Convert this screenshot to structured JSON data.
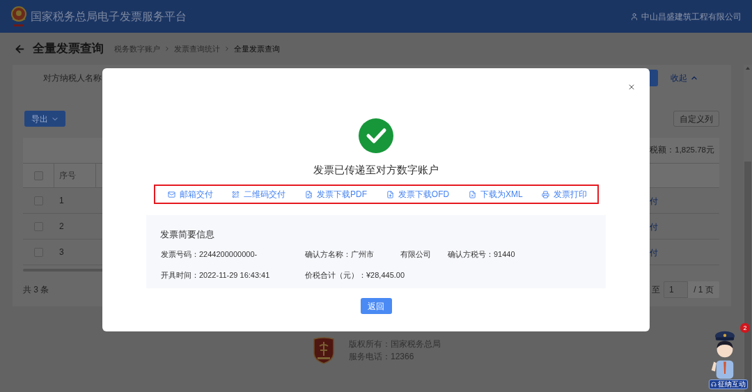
{
  "header": {
    "title": "国家税务总局电子发票服务平台",
    "user": "中山昌盛建筑工程有限公司"
  },
  "page": {
    "title": "全量发票查询",
    "breadcrumbs": [
      {
        "label": "税务数字账户",
        "current": false
      },
      {
        "label": "发票查询统计",
        "current": false
      },
      {
        "label": "全量发票查询",
        "current": true
      }
    ]
  },
  "filter": {
    "label": "对方纳税人名称",
    "collapse_link": "收起"
  },
  "toolbar": {
    "export_button": "导出",
    "columns_button": "自定义列"
  },
  "summary": {
    "text": "税额：1,825.78元"
  },
  "table": {
    "select_all": {
      "checked": false
    },
    "columns": [
      "序号"
    ],
    "rows": [
      {
        "checked": false,
        "index": "1",
        "action": "付"
      },
      {
        "checked": false,
        "index": "2",
        "action": "付"
      },
      {
        "checked": false,
        "index": "3",
        "action": "付"
      }
    ]
  },
  "pagination": {
    "total": "共 3 条",
    "jump_label": "至",
    "page_input": "1",
    "page_count": "/ 1 页"
  },
  "footer": {
    "copyright": "版权所有：国家税务总局",
    "phone": "服务电话：12366"
  },
  "assistant": {
    "badge": "2",
    "label": "征纳互动"
  },
  "dialog": {
    "message": "发票已传递至对方数字账户",
    "actions": [
      {
        "kind": "mail",
        "label": "邮箱交付"
      },
      {
        "kind": "qrcode",
        "label": "二维码交付"
      },
      {
        "kind": "pdf",
        "label": "发票下载PDF"
      },
      {
        "kind": "ofd",
        "label": "发票下载OFD"
      },
      {
        "kind": "xml",
        "label": "下载为XML"
      },
      {
        "kind": "print",
        "label": "发票打印"
      }
    ],
    "info": {
      "title": "发票简要信息",
      "rows": [
        [
          {
            "parts": [
              "发票号码：2244200000000-"
            ]
          },
          {
            "parts": [
              "确认方名称：广州市",
              "有限公司"
            ]
          },
          {
            "parts": [
              "确认方税号：91440"
            ]
          }
        ],
        [
          {
            "parts": [
              "开具时间：2022-11-29 16:43:41"
            ]
          },
          {
            "parts": [
              "价税合计（元）：¥28,445.00"
            ]
          }
        ]
      ]
    },
    "back_button": "返回"
  }
}
